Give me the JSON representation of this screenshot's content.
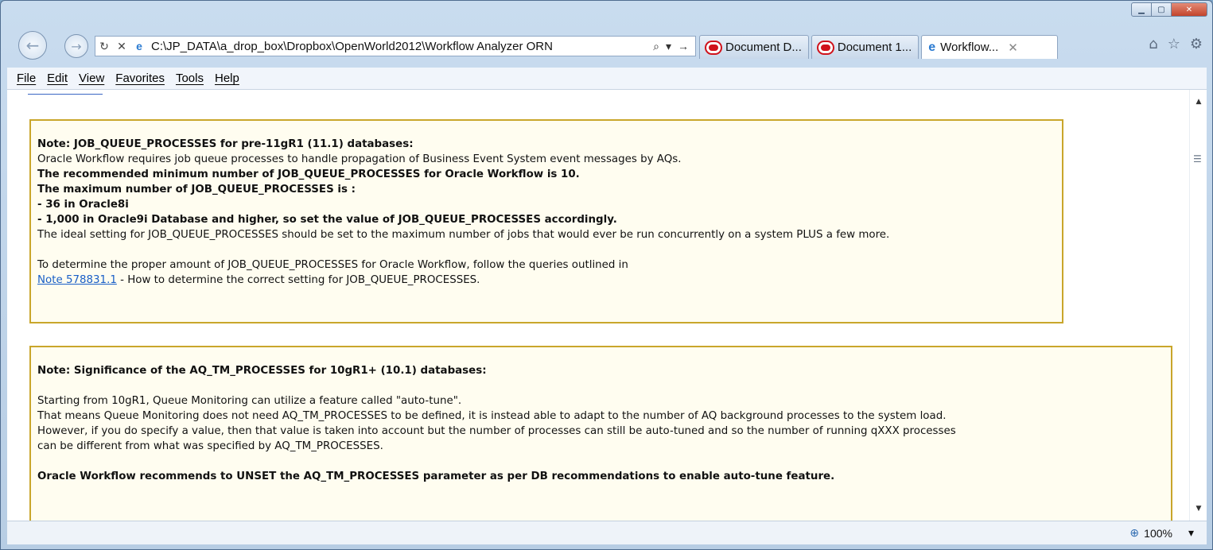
{
  "browser": {
    "address": "C:\\JP_DATA\\a_drop_box\\Dropbox\\OpenWorld2012\\Workflow Analyzer ORN",
    "tabs": [
      {
        "label": "Document D..."
      },
      {
        "label": "Document 1..."
      },
      {
        "label": "Workflow..."
      }
    ]
  },
  "menu": [
    "File",
    "Edit",
    "View",
    "Favorites",
    "Tools",
    "Help"
  ],
  "note1": {
    "title": "Note: JOB_QUEUE_PROCESSES for pre-11gR1 (11.1) databases:",
    "line1": "Oracle Workflow requires job queue processes to handle propagation of Business Event System event messages by AQs.",
    "line2": "The recommended minimum number of JOB_QUEUE_PROCESSES for Oracle Workflow is 10.",
    "line3": "The maximum number of JOB_QUEUE_PROCESSES is :",
    "line4": "- 36 in Oracle8i",
    "line5": "- 1,000 in Oracle9i Database and higher, so set the value of JOB_QUEUE_PROCESSES accordingly.",
    "line6": "The ideal setting for JOB_QUEUE_PROCESSES should be set to the maximum number of jobs that would ever be run concurrently on a system PLUS a few more.",
    "line7": "To determine the proper amount of JOB_QUEUE_PROCESSES for Oracle Workflow, follow the queries outlined in",
    "link": "Note 578831.1",
    "link_suffix": " - How to determine the correct setting for JOB_QUEUE_PROCESSES."
  },
  "note2": {
    "title": "Note: Significance of the AQ_TM_PROCESSES for 10gR1+ (10.1) databases:",
    "line1": "Starting from 10gR1, Queue Monitoring can utilize a feature called \"auto-tune\".",
    "line2": "That means Queue Monitoring does not need AQ_TM_PROCESSES to be defined, it is instead able to adapt to the number of AQ background processes to the system load.",
    "line3": "However, if you do specify a value, then that value is taken into account but the number of processes can still be auto-tuned and so the number of running qXXX processes",
    "line4": "can be different from what was specified by AQ_TM_PROCESSES.",
    "line5": "Oracle Workflow recommends to UNSET the AQ_TM_PROCESSES parameter as per DB recommendations to enable auto-tune feature."
  },
  "status": {
    "zoom": "100%"
  }
}
